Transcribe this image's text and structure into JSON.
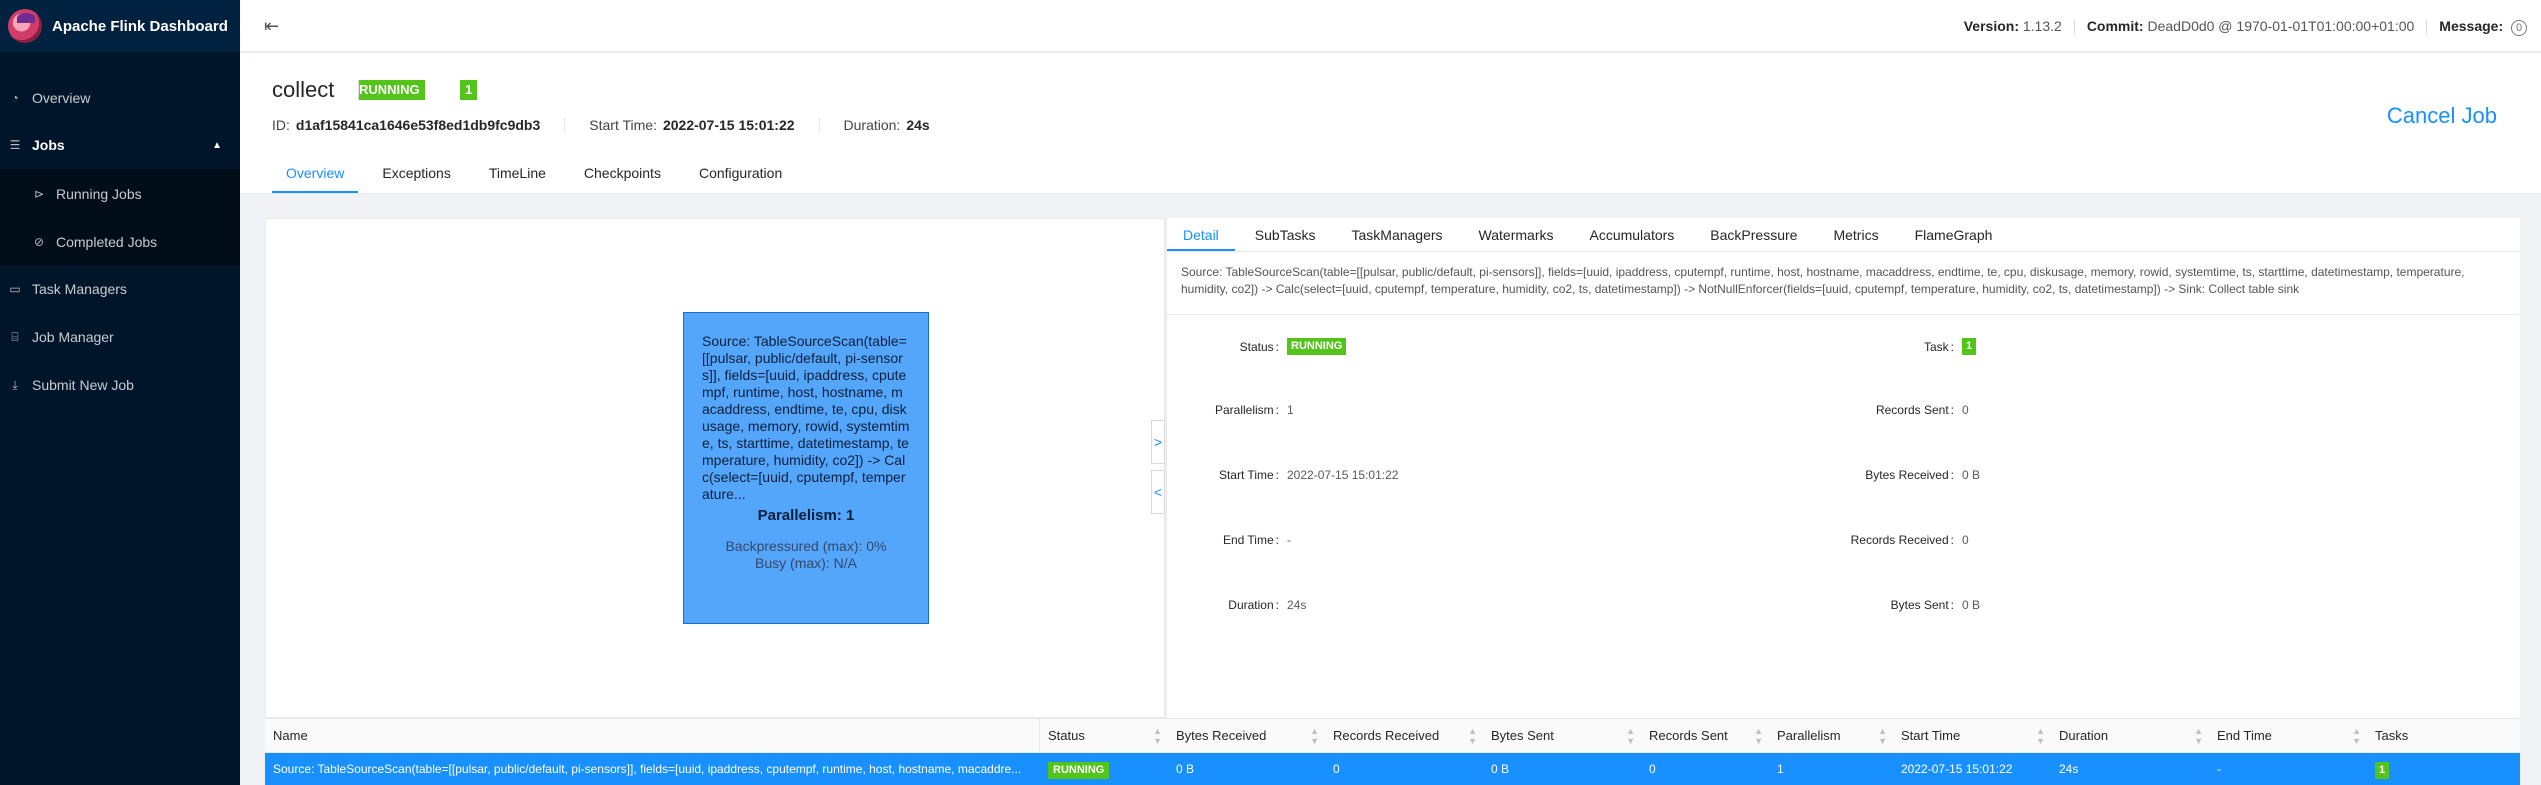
{
  "app": {
    "title": "Apache Flink Dashboard"
  },
  "sidebar": {
    "items": [
      {
        "label": "Overview"
      },
      {
        "label": "Jobs"
      },
      {
        "label": "Running Jobs"
      },
      {
        "label": "Completed Jobs"
      },
      {
        "label": "Task Managers"
      },
      {
        "label": "Job Manager"
      },
      {
        "label": "Submit New Job"
      }
    ]
  },
  "header": {
    "version_label": "Version:",
    "version_value": "1.13.2",
    "commit_label": "Commit:",
    "commit_value": "DeadD0d0 @ 1970-01-01T01:00:00+01:00",
    "message_label": "Message:",
    "message_count": "0"
  },
  "job": {
    "name": "collect",
    "status": "RUNNING",
    "task_count": "1",
    "id_label": "ID:",
    "id_value": "d1af15841ca1646e53f8ed1db9fc9db3",
    "start_label": "Start Time:",
    "start_value": "2022-07-15 15:01:22",
    "duration_label": "Duration:",
    "duration_value": "24s",
    "cancel_label": "Cancel Job",
    "tabs": [
      "Overview",
      "Exceptions",
      "TimeLine",
      "Checkpoints",
      "Configuration"
    ]
  },
  "graph": {
    "node_text": "Source: TableSourceScan(table=[[pulsar, public/default, pi-sensors]], fields=[uuid, ipaddress, cputempf, runtime, host, hostname, macaddress, endtime, te, cpu, diskusage, memory, rowid, systemtime, ts, starttime, datetimestamp, temperature, humidity, co2]) -> Calc(select=[uuid, cputempf, temperature...",
    "parallelism": "Parallelism: 1",
    "backpressured": "Backpressured (max): 0%",
    "busy": "Busy (max): N/A"
  },
  "detail": {
    "tabs": [
      "Detail",
      "SubTasks",
      "TaskManagers",
      "Watermarks",
      "Accumulators",
      "BackPressure",
      "Metrics",
      "FlameGraph"
    ],
    "description": "Source: TableSourceScan(table=[[pulsar, public/default, pi-sensors]], fields=[uuid, ipaddress, cputempf, runtime, host, hostname, macaddress, endtime, te, cpu, diskusage, memory, rowid, systemtime, ts, starttime, datetimestamp, temperature, humidity, co2]) -> Calc(select=[uuid, cputempf, temperature, humidity, co2, ts, datetimestamp]) -> NotNullEnforcer(fields=[uuid, cputempf, temperature, humidity, co2, ts, datetimestamp]) -> Sink: Collect table sink",
    "left": {
      "status_label": "Status",
      "status_value": "RUNNING",
      "parallelism_label": "Parallelism",
      "parallelism_value": "1",
      "start_label": "Start Time",
      "start_value": "2022-07-15 15:01:22",
      "end_label": "End Time",
      "end_value": "-",
      "duration_label": "Duration",
      "duration_value": "24s"
    },
    "right": {
      "task_label": "Task",
      "task_value": "1",
      "records_sent_label": "Records Sent",
      "records_sent_value": "0",
      "bytes_received_label": "Bytes Received",
      "bytes_received_value": "0 B",
      "records_received_label": "Records Received",
      "records_received_value": "0",
      "bytes_sent_label": "Bytes Sent",
      "bytes_sent_value": "0 B"
    }
  },
  "table": {
    "columns": [
      "Name",
      "Status",
      "Bytes Received",
      "Records Received",
      "Bytes Sent",
      "Records Sent",
      "Parallelism",
      "Start Time",
      "Duration",
      "End Time",
      "Tasks"
    ],
    "row": {
      "name": "Source: TableSourceScan(table=[[pulsar, public/default, pi-sensors]], fields=[uuid, ipaddress, cputempf, runtime, host, hostname, macaddre...",
      "status": "RUNNING",
      "bytes_received": "0 B",
      "records_received": "0",
      "bytes_sent": "0 B",
      "records_sent": "0",
      "parallelism": "1",
      "start_time": "2022-07-15 15:01:22",
      "duration": "24s",
      "end_time": "-",
      "tasks": "1"
    }
  },
  "colors": {
    "accent": "#1890ff",
    "running": "#52c41a",
    "sidebar": "#001529",
    "node": "#54a6fb"
  },
  "icons": [
    "flink-logo-icon",
    "dashboard-icon",
    "list-icon",
    "play-circle-icon",
    "check-circle-icon",
    "server-icon",
    "cluster-icon",
    "upload-icon",
    "menu-fold-icon",
    "info-icon",
    "sort-icon"
  ]
}
